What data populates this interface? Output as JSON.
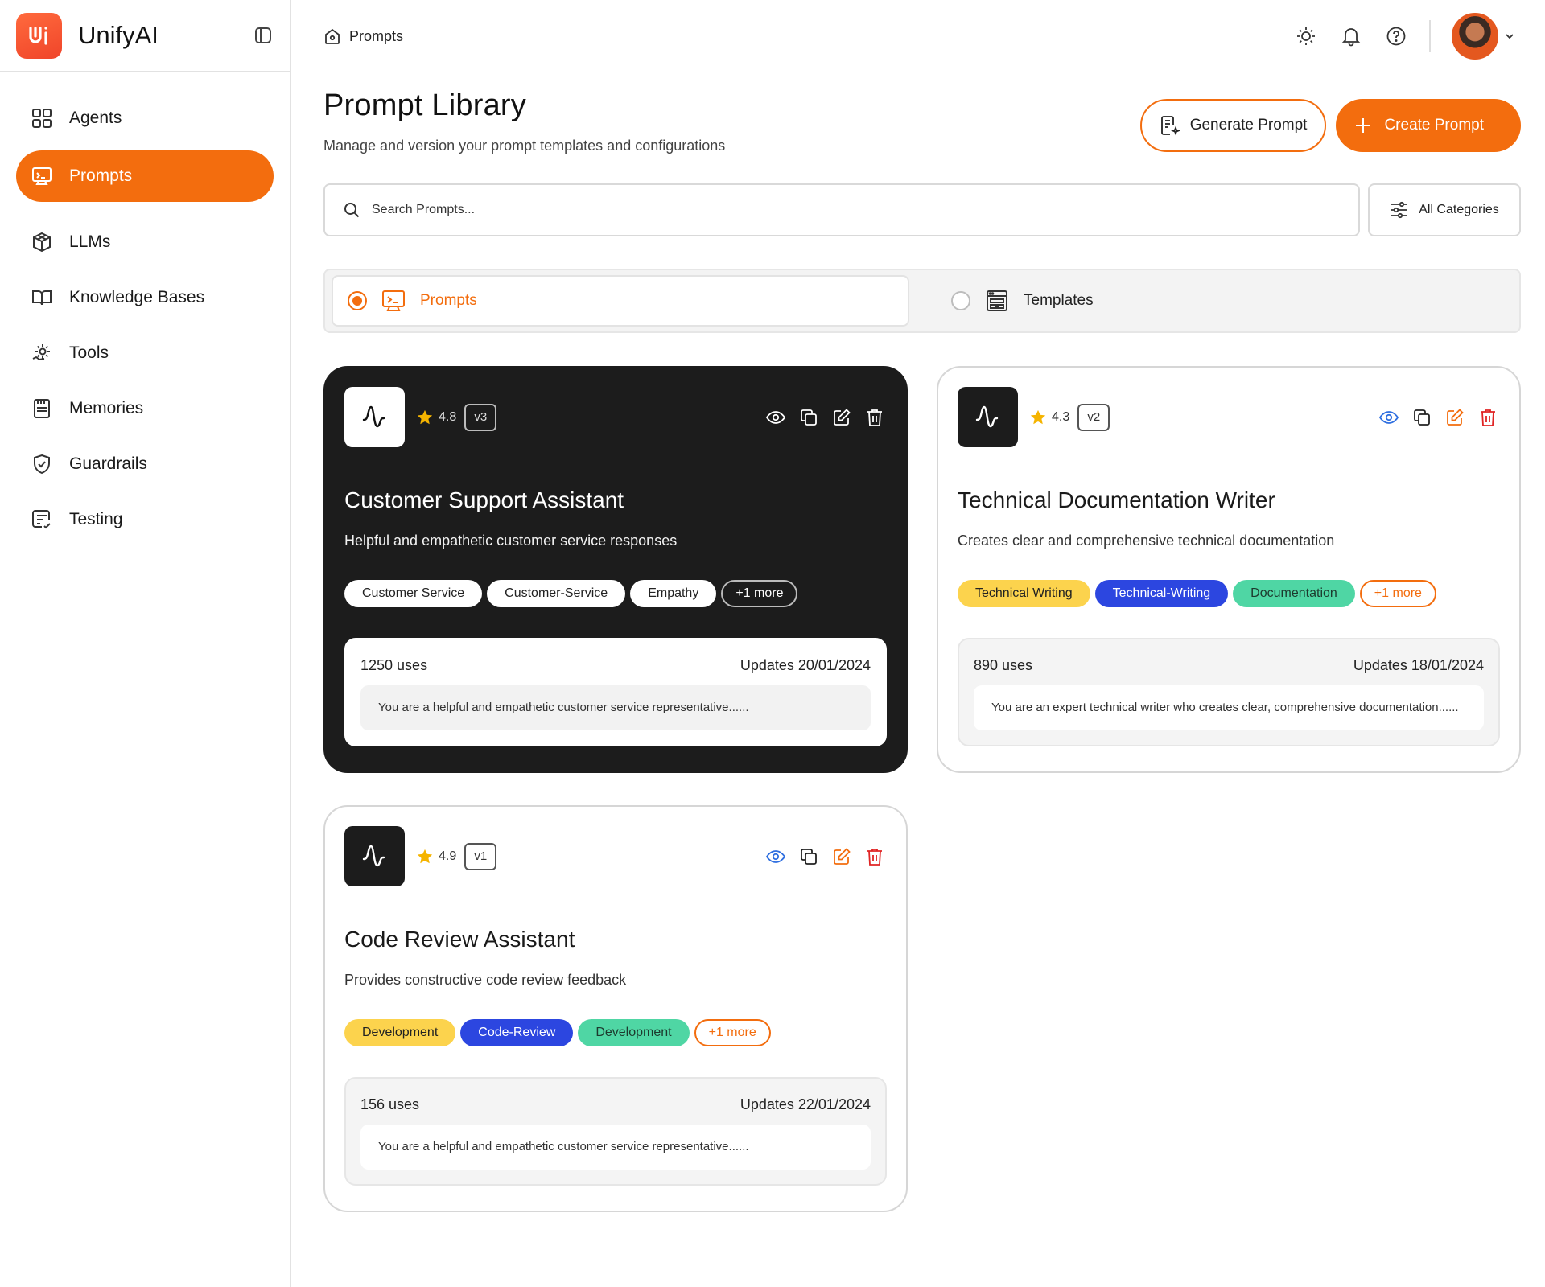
{
  "app": {
    "name": "UnifyAI"
  },
  "sidebar": {
    "items": [
      {
        "label": "Agents",
        "icon": "grid-icon"
      },
      {
        "label": "Prompts",
        "icon": "terminal-icon",
        "active": true
      },
      {
        "label": "LLMs",
        "icon": "cube-network-icon"
      },
      {
        "label": "Knowledge Bases",
        "icon": "book-icon"
      },
      {
        "label": "Tools",
        "icon": "gear-hand-icon"
      },
      {
        "label": "Memories",
        "icon": "memory-card-icon"
      },
      {
        "label": "Guardrails",
        "icon": "shield-icon"
      },
      {
        "label": "Testing",
        "icon": "checklist-icon"
      }
    ]
  },
  "topbar": {
    "breadcrumb": "Prompts"
  },
  "header": {
    "title": "Prompt Library",
    "subtitle": "Manage and version your prompt templates and configurations",
    "generate_label": "Generate Prompt",
    "create_label": "Create Prompt"
  },
  "search": {
    "placeholder": "Search Prompts...",
    "categories_label": "All Categories"
  },
  "toggle": {
    "prompts_label": "Prompts",
    "templates_label": "Templates",
    "selected": "Prompts"
  },
  "cards": [
    {
      "title": "Customer Support Assistant",
      "description": "Helpful and empathetic customer service responses",
      "rating": "4.8",
      "version": "v3",
      "tags": [
        "Customer Service",
        "Customer-Service",
        "Empathy"
      ],
      "more": "+1 more",
      "uses": "1250 uses",
      "updated": "Updates 20/01/2024",
      "preview": "You are a helpful and empathetic customer service representative......"
    },
    {
      "title": "Technical Documentation Writer",
      "description": "Creates clear and comprehensive technical documentation",
      "rating": "4.3",
      "version": "v2",
      "tags": [
        "Technical Writing",
        "Technical-Writing",
        "Documentation"
      ],
      "more": "+1 more",
      "uses": "890 uses",
      "updated": "Updates 18/01/2024",
      "preview": "You are an expert technical writer who creates clear, comprehensive documentation......"
    },
    {
      "title": "Code Review Assistant",
      "description": "Provides constructive code review feedback",
      "rating": "4.9",
      "version": "v1",
      "tags": [
        "Development",
        "Code-Review",
        "Development"
      ],
      "more": "+1 more",
      "uses": "156 uses",
      "updated": "Updates 22/01/2024",
      "preview": "You are a helpful and empathetic customer service representative......"
    }
  ],
  "colors": {
    "accent": "#f36d0e",
    "dark": "#1c1c1c",
    "tag_yellow": "#fcd34d",
    "tag_blue": "#2c46e0",
    "tag_green": "#4fd6a4",
    "star": "#f5b400",
    "delete": "#e02424",
    "view": "#2f6fe0"
  }
}
